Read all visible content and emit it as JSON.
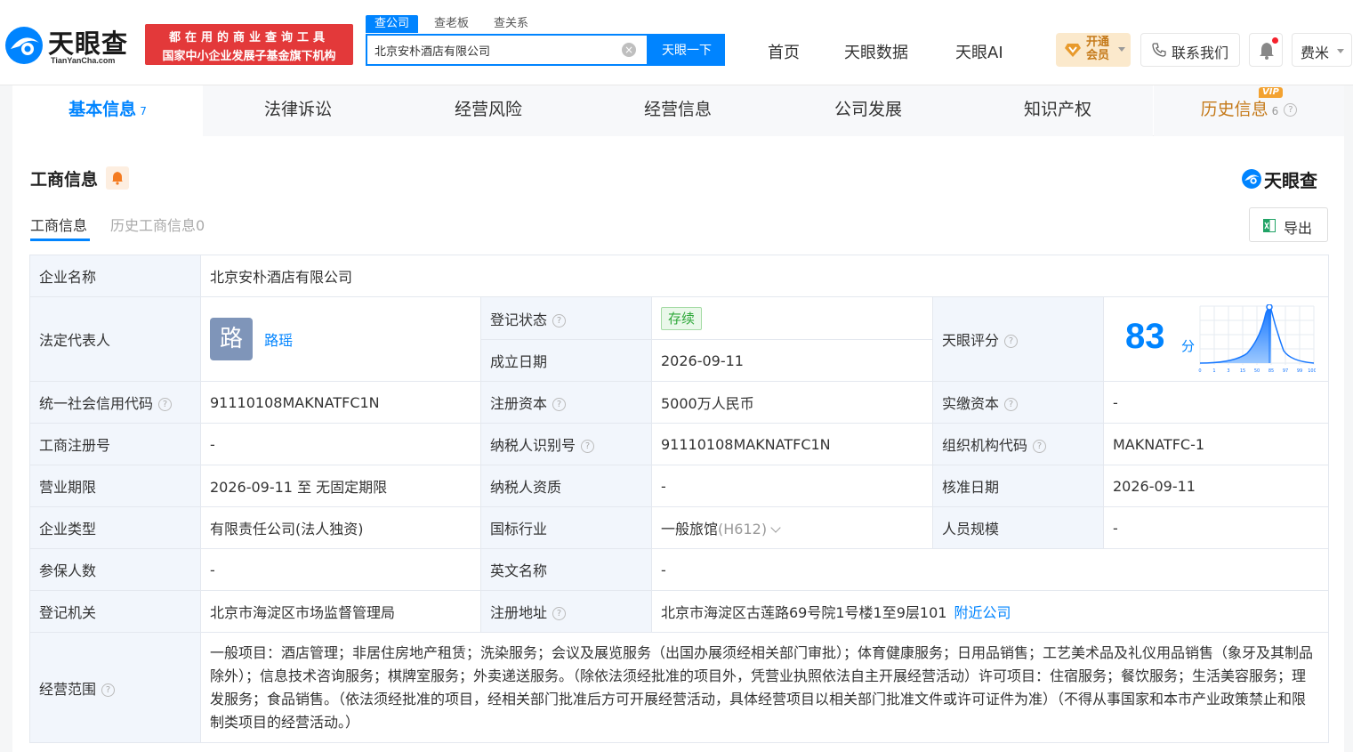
{
  "header": {
    "logo_text": "天眼查",
    "logo_sub": "TianYanCha.com",
    "slogan_line1": "都在用的商业查询工具",
    "slogan_line2": "国家中小企业发展子基金旗下机构",
    "search_tabs": [
      "查公司",
      "查老板",
      "查关系"
    ],
    "search_value": "北京安朴酒店有限公司",
    "search_button": "天眼一下",
    "nav": [
      "首页",
      "天眼数据",
      "天眼AI"
    ],
    "vip_line1": "开通",
    "vip_line2": "会员",
    "contact": "联系我们",
    "user": "费米"
  },
  "main_tabs": [
    {
      "label": "基本信息",
      "count": "7"
    },
    {
      "label": "法律诉讼",
      "count": ""
    },
    {
      "label": "经营风险",
      "count": ""
    },
    {
      "label": "经营信息",
      "count": ""
    },
    {
      "label": "公司发展",
      "count": ""
    },
    {
      "label": "知识产权",
      "count": ""
    },
    {
      "label": "历史信息",
      "count": "6"
    }
  ],
  "vip_badge": "VIP",
  "section": {
    "title": "工商信息",
    "brand": "天眼查",
    "subtabs": [
      "工商信息",
      "历史工商信息0"
    ],
    "export": "导出"
  },
  "info": {
    "company_name_label": "企业名称",
    "company_name": "北京安朴酒店有限公司",
    "legal_rep_label": "法定代表人",
    "legal_rep_avatar": "路",
    "legal_rep_name": "路瑶",
    "reg_status_label": "登记状态",
    "reg_status": "存续",
    "found_date_label": "成立日期",
    "found_date": "2026-09-11",
    "score_label": "天眼评分",
    "score": "83",
    "score_unit": "分",
    "score_ticks": [
      "0",
      "1",
      "3",
      "15",
      "50",
      "85",
      "97",
      "99",
      "100"
    ],
    "credit_code_label": "统一社会信用代码",
    "credit_code": "91110108MAKNATFC1N",
    "reg_capital_label": "注册资本",
    "reg_capital": "5000万人民币",
    "paid_capital_label": "实缴资本",
    "paid_capital": "-",
    "reg_no_label": "工商注册号",
    "reg_no": "-",
    "taxpayer_id_label": "纳税人识别号",
    "taxpayer_id": "91110108MAKNATFC1N",
    "org_code_label": "组织机构代码",
    "org_code": "MAKNATFC-1",
    "biz_term_label": "营业期限",
    "biz_term": "2026-09-11 至 无固定期限",
    "taxpayer_qual_label": "纳税人资质",
    "taxpayer_qual": "-",
    "approve_date_label": "核准日期",
    "approve_date": "2026-09-11",
    "company_type_label": "企业类型",
    "company_type": "有限责任公司(法人独资)",
    "industry_label": "国标行业",
    "industry": "一般旅馆",
    "industry_code": "(H612)",
    "staff_size_label": "人员规模",
    "staff_size": "-",
    "insured_label": "参保人数",
    "insured": "-",
    "english_name_label": "英文名称",
    "english_name": "-",
    "reg_authority_label": "登记机关",
    "reg_authority": "北京市海淀区市场监督管理局",
    "reg_address_label": "注册地址",
    "reg_address": "北京市海淀区古莲路69号院1号楼1至9层101",
    "nearby_link": "附近公司",
    "scope_label": "经营范围",
    "scope": "一般项目：酒店管理；非居住房地产租赁；洗染服务；会议及展览服务（出国办展须经相关部门审批）；体育健康服务；日用品销售；工艺美术品及礼仪用品销售（象牙及其制品除外）；信息技术咨询服务；棋牌室服务；外卖递送服务。（除依法须经批准的项目外，凭营业执照依法自主开展经营活动）许可项目：住宿服务；餐饮服务；生活美容服务；理发服务；食品销售。（依法须经批准的项目，经相关部门批准后方可开展经营活动，具体经营项目以相关部门批准文件或许可证件为准）（不得从事国家和本市产业政策禁止和限制类项目的经营活动。）"
  },
  "colors": {
    "accent": "#0084ff",
    "brand_red": "#e3393a",
    "status_green": "#2fa83a",
    "vip_gold": "#c57a1a"
  }
}
